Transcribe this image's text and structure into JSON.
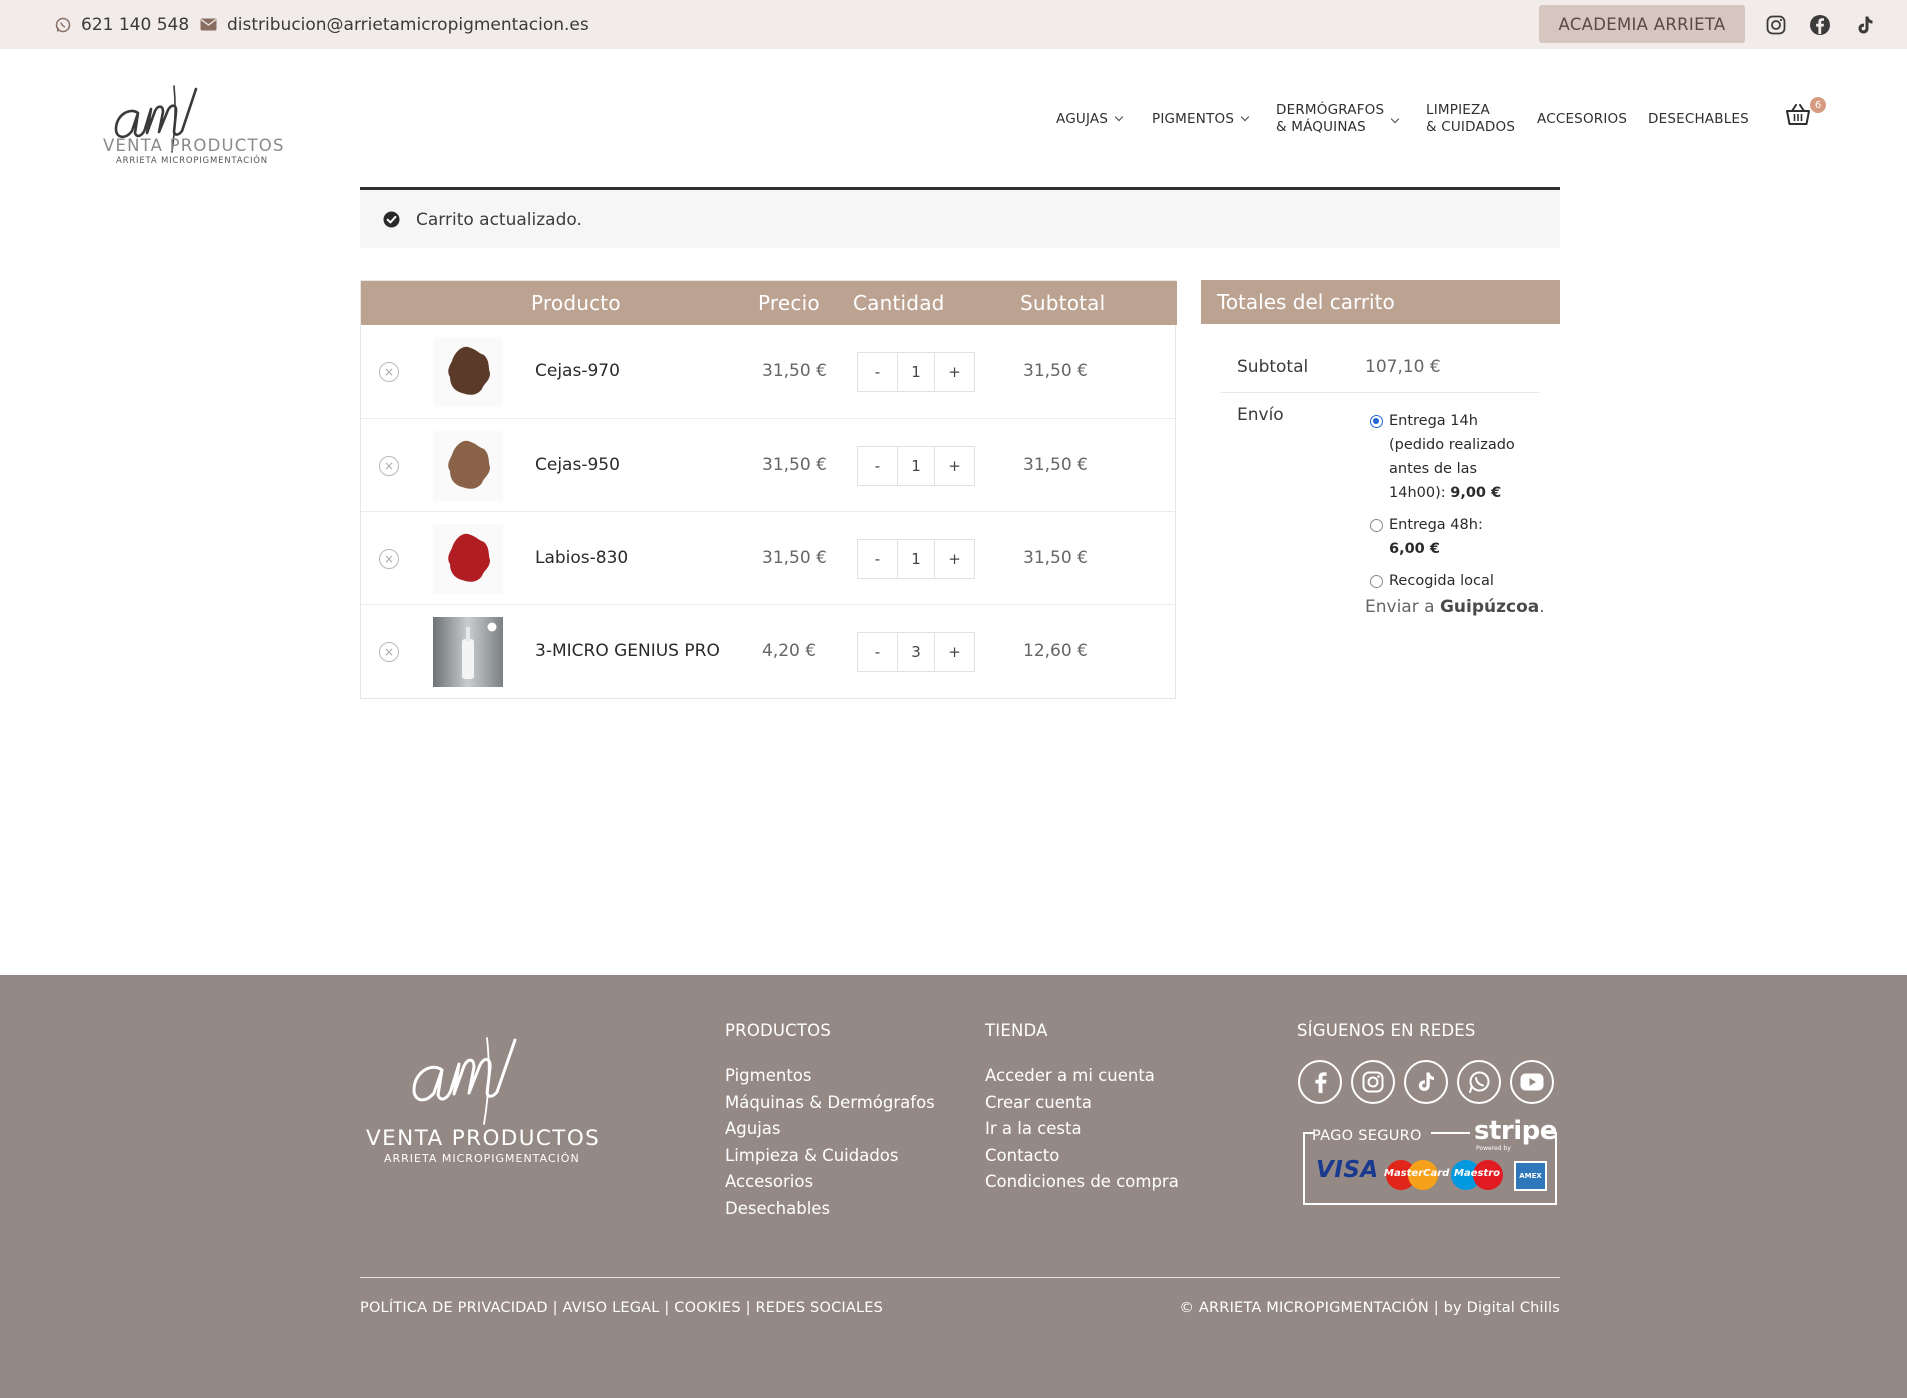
{
  "topbar": {
    "phone": "621 140 548",
    "email": "distribucion@arrietamicropigmentacion.es",
    "academia_label": "ACADEMIA ARRIETA",
    "social_icons": [
      "instagram-icon",
      "facebook-icon",
      "tiktok-icon"
    ]
  },
  "logo": {
    "script": "am",
    "title": "VENTA PRODUCTOS",
    "subtitle": "ARRIETA MICROPIGMENTACIÓN"
  },
  "nav": {
    "agujas": "AGUJAS",
    "pigmentos": "PIGMENTOS",
    "dermografos_1": "DERMÓGRAFOS",
    "dermografos_2": "& MÁQUINAS",
    "limpieza_1": "LIMPIEZA",
    "limpieza_2": "& CUIDADOS",
    "accesorios": "ACCESORIOS",
    "desechables": "DESECHABLES",
    "cart_count": "6"
  },
  "notice": {
    "text": "Carrito actualizado."
  },
  "cart": {
    "headers": {
      "product": "Producto",
      "price": "Precio",
      "quantity": "Cantidad",
      "subtotal": "Subtotal"
    },
    "items": [
      {
        "name": "Cejas-970",
        "price": "31,50 €",
        "qty": "1",
        "subtotal": "31,50 €",
        "swatch": "#5b3a29"
      },
      {
        "name": "Cejas-950",
        "price": "31,50 €",
        "qty": "1",
        "subtotal": "31,50 €",
        "swatch": "#8a6247"
      },
      {
        "name": "Labios-830",
        "price": "31,50 €",
        "qty": "1",
        "subtotal": "31,50 €",
        "swatch": "#b01e24"
      },
      {
        "name": "3-MICRO GENIUS PRO",
        "price": "4,20 €",
        "qty": "3",
        "subtotal": "12,60 €",
        "swatch": "#9aa0a3"
      }
    ],
    "minus": "-",
    "plus": "+"
  },
  "totals": {
    "title": "Totales del carrito",
    "subtotal_label": "Subtotal",
    "subtotal_value": "107,10 €",
    "shipping_label": "Envío",
    "shipping_options": [
      {
        "text": "Entrega 14h (pedido realizado antes de las 14h00):",
        "price": "9,00 €",
        "selected": true
      },
      {
        "text": "Entrega 48h:",
        "price": "6,00 €",
        "selected": false
      },
      {
        "text": "Recogida local",
        "price": "",
        "selected": false
      }
    ],
    "send_to_prefix": "Enviar a ",
    "send_to_region": "Guipúzcoa",
    "send_to_suffix": "."
  },
  "footer": {
    "productos_title": "PRODUCTOS",
    "productos": [
      "Pigmentos",
      "Máquinas & Dermógrafos",
      "Agujas",
      "Limpieza & Cuidados",
      "Accesorios",
      "Desechables"
    ],
    "tienda_title": "TIENDA",
    "tienda": [
      "Acceder a mi cuenta",
      "Crear cuenta",
      "Ir a la cesta",
      "Contacto",
      "Condiciones de compra"
    ],
    "social_title": "SÍGUENOS EN REDES",
    "social_icons": [
      "facebook-icon",
      "instagram-icon",
      "tiktok-icon",
      "whatsapp-icon",
      "youtube-icon"
    ],
    "pago_seguro": "PAGO SEGURO",
    "stripe": "stripe",
    "stripe_powered": "Powered by",
    "cards": [
      "VISA",
      "MasterCard",
      "Maestro",
      "AMEX"
    ],
    "legal": "POLÍTICA DE PRIVACIDAD | AVISO LEGAL | COOKIES | REDES SOCIALES",
    "copyright": "© ARRIETA MICROPIGMENTACIÓN | by Digital Chills"
  },
  "colors": {
    "header_accent": "#bca291",
    "footer_bg": "#948985",
    "topbar_bg": "#f1ecea",
    "academia_bg": "#d6c6c0",
    "radio_selected": "#1e66d6"
  }
}
